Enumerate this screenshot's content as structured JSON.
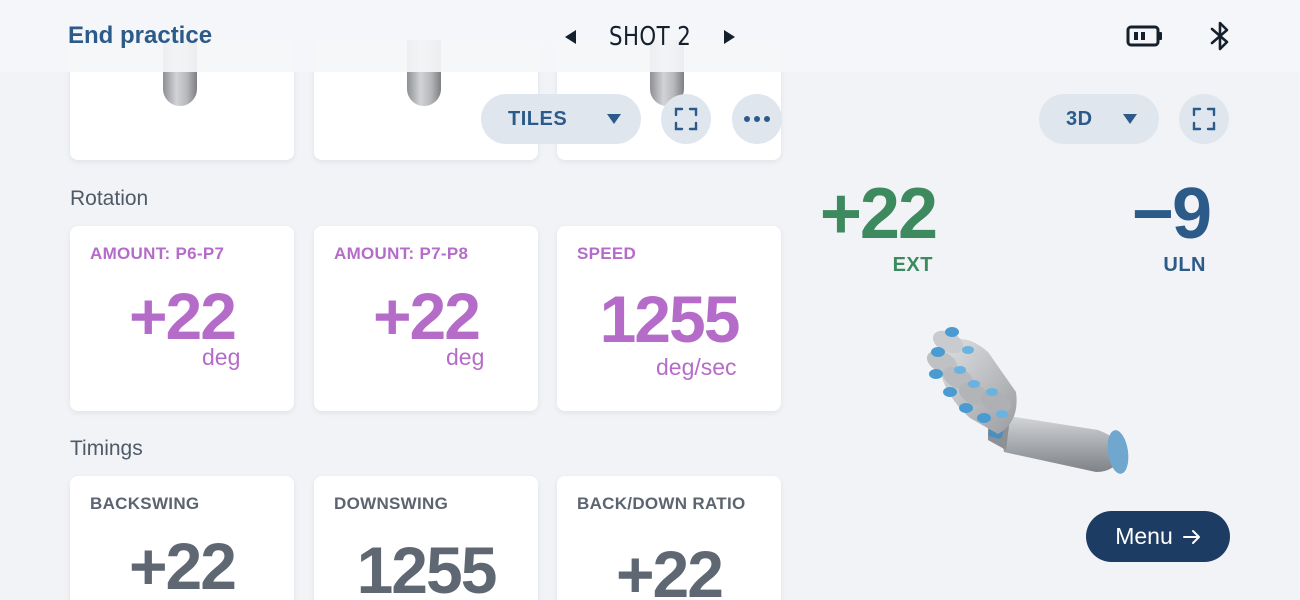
{
  "header": {
    "end_practice_label": "End practice",
    "shot_label": "SHOT 2",
    "icons": [
      "caret-left-icon",
      "caret-right-icon",
      "battery-icon",
      "bluetooth-icon"
    ]
  },
  "tiles_view": {
    "view_select_label": "TILES",
    "icons": [
      "chevron-down-icon",
      "expand-icon",
      "more-icon"
    ]
  },
  "rotation": {
    "section_title": "Rotation",
    "tiles": [
      {
        "label": "AMOUNT: P6-P7",
        "value": "+22",
        "unit": "deg"
      },
      {
        "label": "AMOUNT: P7-P8",
        "value": "+22",
        "unit": "deg"
      },
      {
        "label": "SPEED",
        "value": "1255",
        "unit": "deg/sec"
      }
    ]
  },
  "timings": {
    "section_title": "Timings",
    "tiles": [
      {
        "label": "BACKSWING",
        "value": "+22"
      },
      {
        "label": "DOWNSWING",
        "value": "1255"
      },
      {
        "label": "BACK/DOWN RATIO",
        "value": "+22"
      }
    ]
  },
  "model_view": {
    "view_select_label": "3D",
    "extension": {
      "value": "+22",
      "label": "EXT",
      "color": "#3d8a5e"
    },
    "ulnar": {
      "value": "−9",
      "label": "ULN",
      "color": "#2c5b8a"
    }
  },
  "menu_button_label": "Menu",
  "colors": {
    "accent_blue": "#2c5b8a",
    "rotation_purple": "#b56cc9",
    "timing_grey": "#5f6872",
    "menu_navy": "#1c3c64",
    "background": "#f1f3f6"
  }
}
